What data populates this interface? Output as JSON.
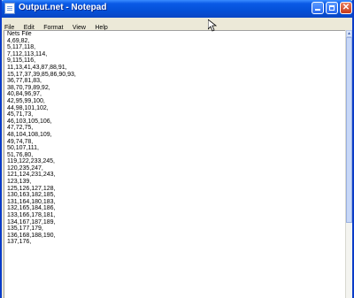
{
  "window": {
    "title": "Output.net - Notepad"
  },
  "titlebar_buttons": {
    "close_glyph": "✕"
  },
  "menu": [
    "File",
    "Edit",
    "Format",
    "View",
    "Help"
  ],
  "content_lines": [
    "Nets File",
    "4,69,82,",
    "5,117,118,",
    "7,112,113,114,",
    "9,115,116,",
    "11,13,41,43,87,88,91,",
    "15,17,37,39,85,86,90,93,",
    "36,77,81,83,",
    "38,70,79,89,92,",
    "40,84,96,97,",
    "42,95,99,100,",
    "44,98,101,102,",
    "45,71,73,",
    "46,103,105,106,",
    "47,72,75,",
    "48,104,108,109,",
    "49,74,78,",
    "50,107,111,",
    "51,76,80,",
    "119,122,233,245,",
    "120,235,247,",
    "121,124,231,243,",
    "123,139,",
    "125,126,127,128,",
    "130,163,182,185,",
    "131,164,180,183,",
    "132,165,184,186,",
    "133,166,178,181,",
    "134,167,187,189,",
    "135,177,179,",
    "136,168,188,190,",
    "137,176,"
  ],
  "colors": {
    "titlebar": "#0450d8",
    "close_button": "#c83a1a",
    "chrome": "#ece9d8"
  }
}
